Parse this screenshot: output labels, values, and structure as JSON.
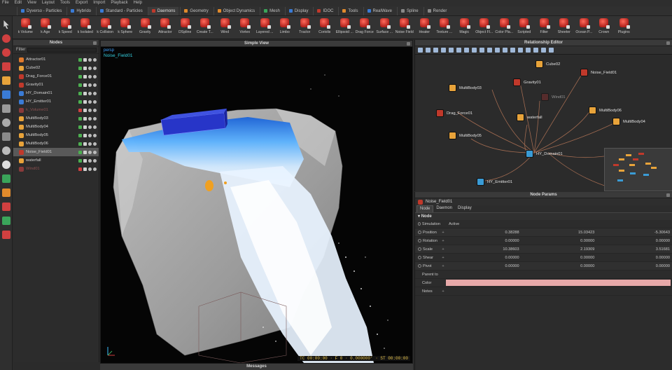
{
  "menu": [
    "File",
    "Edit",
    "View",
    "Layout",
    "Tools",
    "Export",
    "Import",
    "Playback",
    "Help"
  ],
  "shelf_tabs": [
    {
      "label": "Dyverso - Particles",
      "color": "#3a7bd5",
      "active": false
    },
    {
      "label": "Hybrido",
      "color": "#3a7bd5",
      "active": false
    },
    {
      "label": "Standard - Particles",
      "color": "#3a7bd5",
      "active": false
    },
    {
      "label": "Daemons",
      "color": "#c0392b",
      "active": true
    },
    {
      "label": "Geometry",
      "color": "#e08a2c",
      "active": false
    },
    {
      "label": "Object Dynamics",
      "color": "#e08a2c",
      "active": false
    },
    {
      "label": "Mesh",
      "color": "#3aa55a",
      "active": false
    },
    {
      "label": "Display",
      "color": "#3a7bd5",
      "active": false
    },
    {
      "label": "IDOC",
      "color": "#c0392b",
      "active": false
    },
    {
      "label": "Tools",
      "color": "#e08a2c",
      "active": false
    },
    {
      "label": "RealWave",
      "color": "#3a7bd5",
      "active": false
    },
    {
      "label": "Spline",
      "color": "#888888",
      "active": false
    },
    {
      "label": "Render",
      "color": "#888888",
      "active": false
    }
  ],
  "tools": [
    "k Volume",
    "k Age",
    "k Speed",
    "k Isolated",
    "k Collision",
    "k Sphere",
    "Gravity",
    "Attractor",
    "DSpline",
    "Create T...",
    "Wind",
    "Vortex",
    "Layered ...",
    "Limbo",
    "Tractor",
    "Coriolis",
    "Ellipsoid ...",
    "Drag Force",
    "Surface ...",
    "Noise Field",
    "Heater",
    "Texture ...",
    "Magic",
    "Object Fl...",
    "Color Pla...",
    "Scripted",
    "Filter",
    "Sheeter",
    "Ocean P...",
    "Crown",
    "Plugins"
  ],
  "nodes_panel": {
    "title": "Nodes",
    "filter_label": "Filter",
    "items": [
      {
        "label": "Attractor01",
        "color": "#e07a2c",
        "selected": false,
        "disabled": false
      },
      {
        "label": "Cube02",
        "color": "#e8a33a",
        "selected": false,
        "disabled": false
      },
      {
        "label": "Drag_Force01",
        "color": "#c0392b",
        "selected": false,
        "disabled": false
      },
      {
        "label": "Gravity01",
        "color": "#c0392b",
        "selected": false,
        "disabled": false
      },
      {
        "label": "HY_Domain01",
        "color": "#3a7bd5",
        "selected": false,
        "disabled": false
      },
      {
        "label": "HY_Emitter01",
        "color": "#3a7bd5",
        "selected": false,
        "disabled": false
      },
      {
        "label": "k_Volume01",
        "color": "#8a3a3a",
        "selected": false,
        "disabled": true
      },
      {
        "label": "MultiBody03",
        "color": "#e8a33a",
        "selected": false,
        "disabled": false
      },
      {
        "label": "MultiBody04",
        "color": "#e8a33a",
        "selected": false,
        "disabled": false
      },
      {
        "label": "MultiBody05",
        "color": "#e8a33a",
        "selected": false,
        "disabled": false
      },
      {
        "label": "MultiBody06",
        "color": "#e8a33a",
        "selected": false,
        "disabled": false
      },
      {
        "label": "Noise_Field01",
        "color": "#c0392b",
        "selected": true,
        "disabled": false
      },
      {
        "label": "waterfall",
        "color": "#e8a33a",
        "selected": false,
        "disabled": false
      },
      {
        "label": "Wind01",
        "color": "#8a3a3a",
        "selected": false,
        "disabled": true
      }
    ]
  },
  "viewport": {
    "title": "Simple View",
    "camera": "persp",
    "selected_node": "Noise_Field01",
    "hud": "TC 00:00:00 · F 0 · 0.000000' · ST 00:00:00"
  },
  "messages_title": "Messages",
  "relationship_editor": {
    "title": "Relationship Editor",
    "nodes": [
      {
        "label": "Cube02",
        "color": "#e8a33a"
      },
      {
        "label": "Noise_Field01",
        "color": "#c0392b"
      },
      {
        "label": "MultiBody03",
        "color": "#e8a33a"
      },
      {
        "label": "Gravity01",
        "color": "#c0392b"
      },
      {
        "label": "Wind01",
        "color": "#7a2e2e"
      },
      {
        "label": "Drag_Force01",
        "color": "#c0392b"
      },
      {
        "label": "waterfall",
        "color": "#e8a33a"
      },
      {
        "label": "MultiBody06",
        "color": "#e8a33a"
      },
      {
        "label": "MultiBody04",
        "color": "#e8a33a"
      },
      {
        "label": "MultiBody05",
        "color": "#e8a33a"
      },
      {
        "label": "HY_Domain01",
        "color": "#3a9bd5"
      },
      {
        "label": "HY_Emitter01",
        "color": "#3a9bd5"
      }
    ]
  },
  "node_params": {
    "title": "Node Params",
    "node_name": "Noise_Field01",
    "tabs": [
      "Node",
      "Daemon",
      "Display"
    ],
    "section": "Node",
    "simulation": {
      "label": "Simulation",
      "value": "Active"
    },
    "vectors": [
      {
        "label": "Position",
        "x": "0.38288",
        "y": "15.03423",
        "z": "-5.30643"
      },
      {
        "label": "Rotation",
        "x": "0.00000",
        "y": "0.00000",
        "z": "0.00000"
      },
      {
        "label": "Scale",
        "x": "10.38603",
        "y": "2.19309",
        "z": "3.51681"
      },
      {
        "label": "Shear",
        "x": "0.00000",
        "y": "0.00000",
        "z": "0.00000"
      },
      {
        "label": "Pivot",
        "x": "0.00000",
        "y": "0.00000",
        "z": "0.00000"
      }
    ],
    "parent_to_label": "Parent to",
    "color_label": "Color",
    "color_value": "#e7a9a9",
    "notes_label": "Notes"
  }
}
